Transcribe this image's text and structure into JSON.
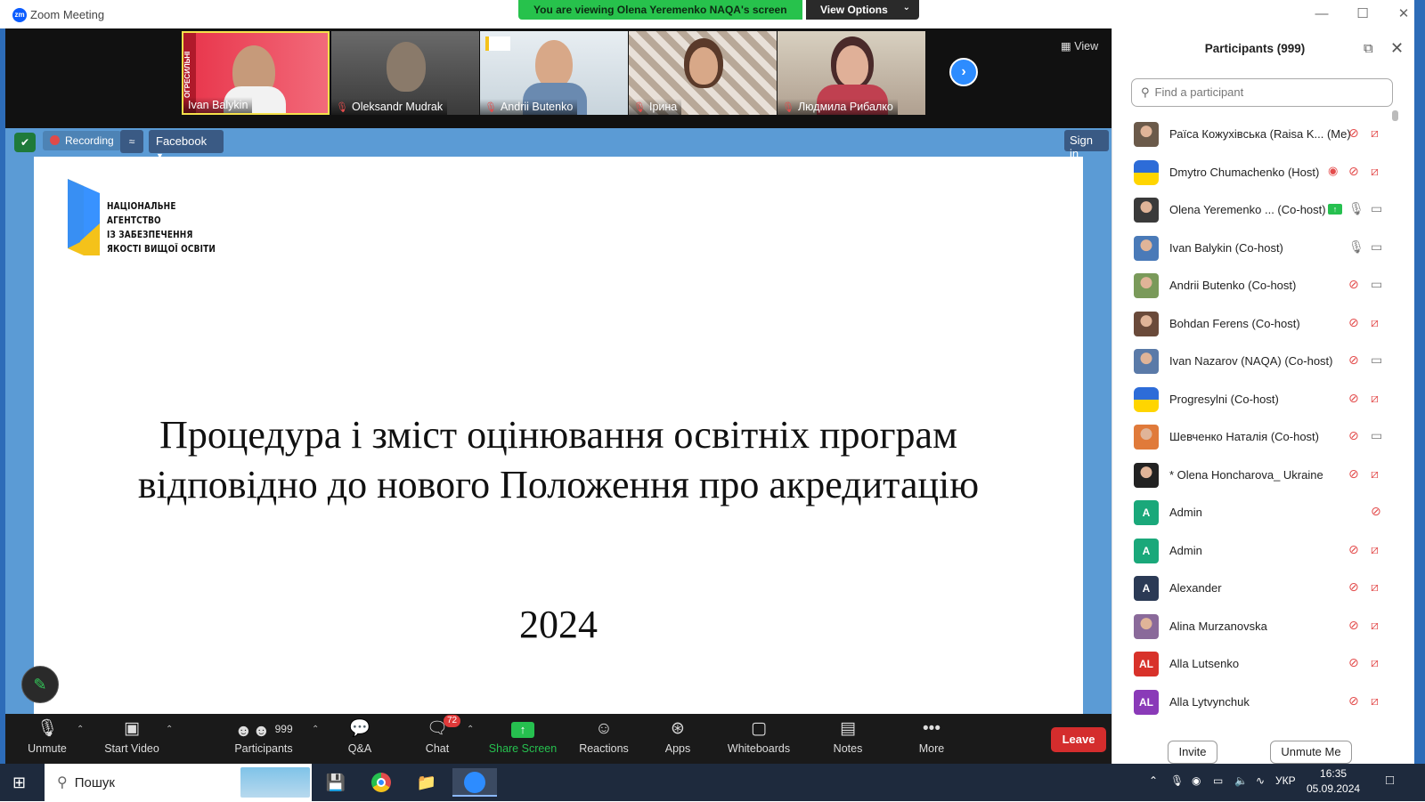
{
  "window": {
    "title": "Zoom Meeting",
    "logo": "zm"
  },
  "banner": {
    "viewing": "You are viewing Olena Yeremenko NAQA's screen",
    "view_options": "View Options"
  },
  "strip": {
    "tiles": [
      {
        "name": "Ivan Balykin",
        "muted": false
      },
      {
        "name": "Oleksandr Mudrak",
        "muted": true
      },
      {
        "name": "Andrii Butenko",
        "muted": true
      },
      {
        "name": "Ірина",
        "muted": true
      },
      {
        "name": "Людмила Рибалко",
        "muted": true
      }
    ],
    "view_label": "View"
  },
  "sharebar": {
    "recording": "Recording",
    "facebook": "Facebook",
    "signin": "Sign in"
  },
  "slide": {
    "logo_lines": [
      "НАЦІОНАЛЬНЕ",
      "АГЕНТСТВО",
      "ІЗ ЗАБЕЗПЕЧЕННЯ",
      "ЯКОСТІ ВИЩОЇ ОСВІТИ"
    ],
    "title_line1": "Процедура і зміст оцінювання освітніх програм",
    "title_line2": "відповідно до нового Положення про акредитацію",
    "year": "2024"
  },
  "toolbar": {
    "unmute": "Unmute",
    "start_video": "Start Video",
    "participants": "Participants",
    "participants_count": "999",
    "qa": "Q&A",
    "chat": "Chat",
    "chat_badge": "72",
    "share_screen": "Share Screen",
    "reactions": "Reactions",
    "apps": "Apps",
    "whiteboards": "Whiteboards",
    "notes": "Notes",
    "more": "More",
    "leave": "Leave"
  },
  "panel": {
    "title": "Participants (999)",
    "search_placeholder": "Find a participant",
    "invite": "Invite",
    "unmute_me": "Unmute Me",
    "participants": [
      {
        "name": "Раїса Кожухівська (Raisa K... (Me)",
        "avatar": "photo",
        "color": "#6b5a4a",
        "initials": "",
        "mic": "muted",
        "cam": "off"
      },
      {
        "name": "Dmytro Chumachenko (Host)",
        "avatar": "flag",
        "color": "#ffd500",
        "initials": "",
        "mic": "muted",
        "cam": "off",
        "recording": true
      },
      {
        "name": "Olena Yeremenko ... (Co-host)",
        "avatar": "photo",
        "color": "#3a3a3a",
        "initials": "",
        "mic": "on",
        "cam": "on",
        "sharing": true
      },
      {
        "name": "Ivan Balykin (Co-host)",
        "avatar": "photo",
        "color": "#4a7ab8",
        "initials": "",
        "mic": "on",
        "cam": "on"
      },
      {
        "name": "Andrii Butenko (Co-host)",
        "avatar": "photo",
        "color": "#7a9a5a",
        "initials": "",
        "mic": "muted",
        "cam": "on"
      },
      {
        "name": "Bohdan Ferens (Co-host)",
        "avatar": "photo",
        "color": "#6a4a3a",
        "initials": "",
        "mic": "muted",
        "cam": "off"
      },
      {
        "name": "Ivan Nazarov (NAQA) (Co-host)",
        "avatar": "photo",
        "color": "#5a7aa8",
        "initials": "",
        "mic": "muted",
        "cam": "on"
      },
      {
        "name": "Progresylni (Co-host)",
        "avatar": "flag",
        "color": "#ffd500",
        "initials": "",
        "mic": "muted",
        "cam": "off"
      },
      {
        "name": "Шевченко Наталія (Co-host)",
        "avatar": "photo",
        "color": "#e07a3a",
        "initials": "",
        "mic": "muted",
        "cam": "on"
      },
      {
        "name": "* Olena Honcharova_ Ukraine",
        "avatar": "photo",
        "color": "#222222",
        "initials": "",
        "mic": "muted",
        "cam": "off"
      },
      {
        "name": "Admin",
        "avatar": "initials",
        "color": "#1aa87a",
        "initials": "A",
        "mic": "none",
        "cam": "muted-only"
      },
      {
        "name": "Admin",
        "avatar": "initials",
        "color": "#1aa87a",
        "initials": "A",
        "mic": "muted",
        "cam": "off"
      },
      {
        "name": "Alexander",
        "avatar": "initials",
        "color": "#2b3a55",
        "initials": "A",
        "mic": "muted",
        "cam": "off"
      },
      {
        "name": "Alina Murzanovska",
        "avatar": "photo",
        "color": "#8a6a9a",
        "initials": "",
        "mic": "muted",
        "cam": "off"
      },
      {
        "name": "Alla Lutsenko",
        "avatar": "initials",
        "color": "#d8322a",
        "initials": "AL",
        "mic": "muted",
        "cam": "off"
      },
      {
        "name": "Alla Lytvynchuk",
        "avatar": "initials",
        "color": "#8a3ab8",
        "initials": "AL",
        "mic": "muted",
        "cam": "off"
      }
    ]
  },
  "taskbar": {
    "search_label": "Пошук",
    "lang": "УКР",
    "time": "16:35",
    "date": "05.09.2024"
  },
  "colors": {
    "accent": "#0b5cff",
    "share_green": "#26c04f",
    "leave_red": "#d42d2d",
    "slide_bg": "#5b9bd5",
    "naqa_yellow": "#f4c21a"
  }
}
